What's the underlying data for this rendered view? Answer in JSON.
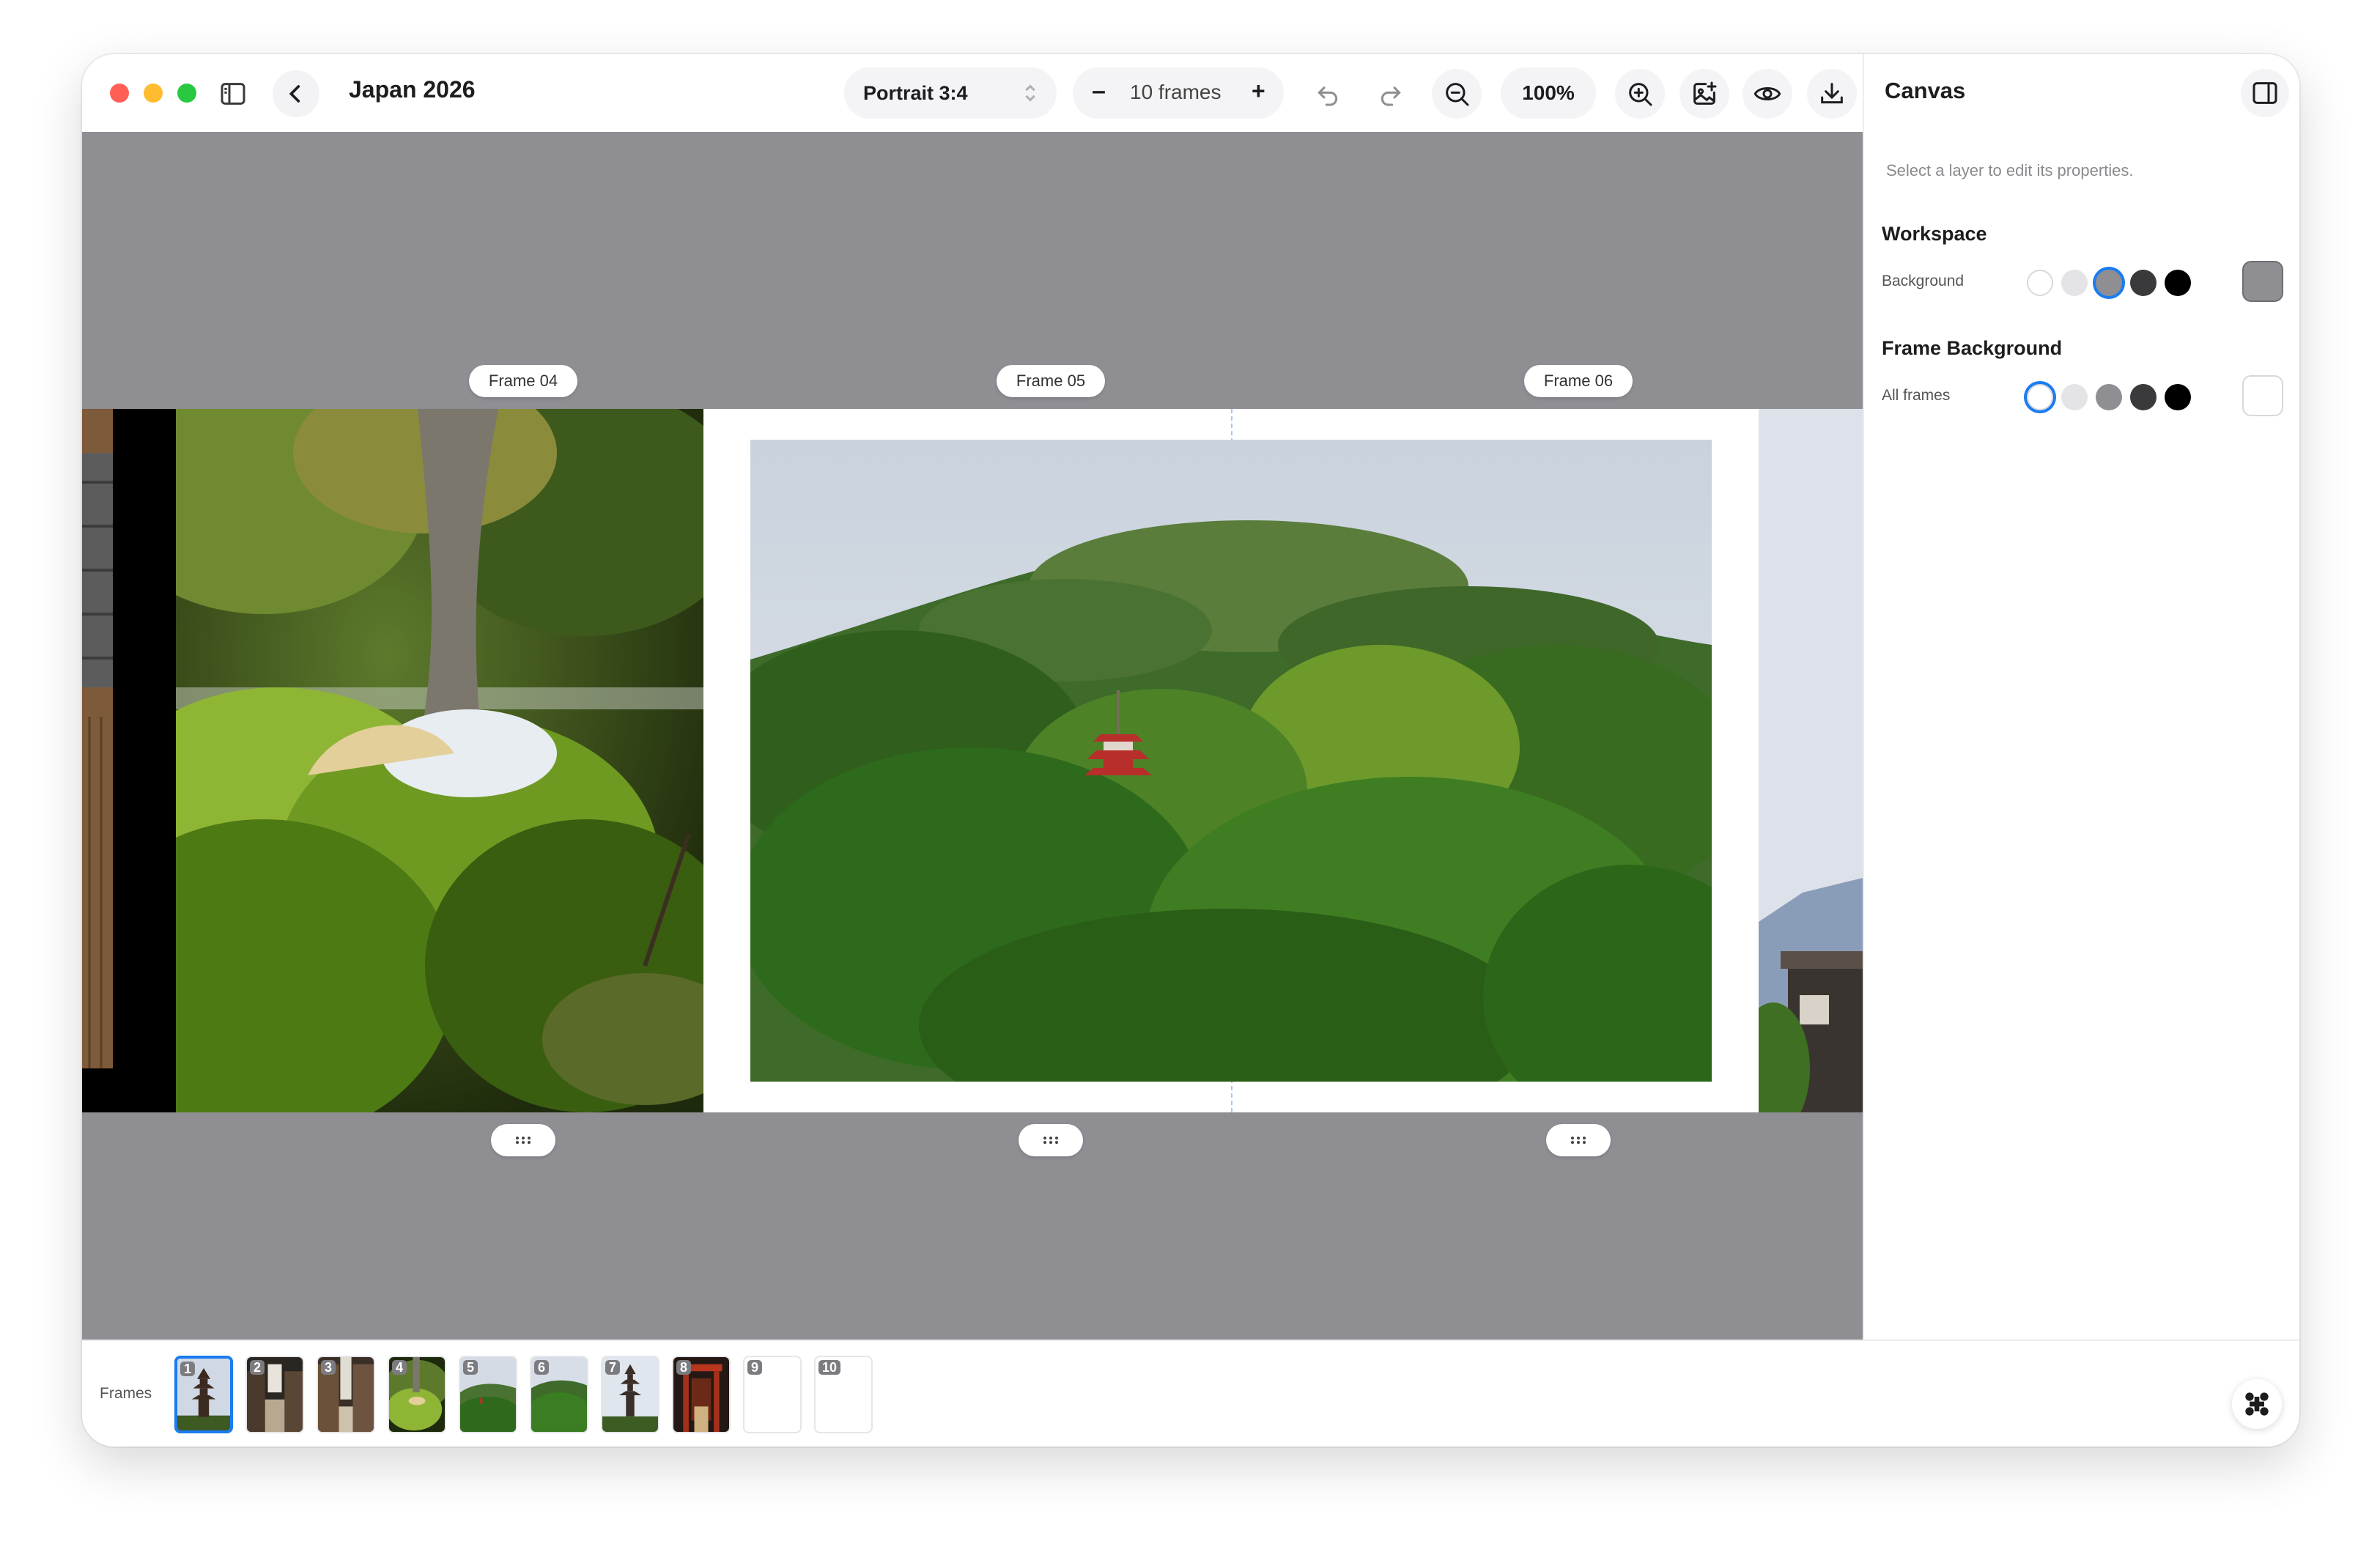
{
  "app": {
    "title": "Japan 2026"
  },
  "toolbar": {
    "aspect_ratio": "Portrait 3:4",
    "frame_count": "10 frames",
    "minus": "–",
    "plus": "+",
    "zoom": "100%"
  },
  "canvas": {
    "background": "#8e8e93",
    "frame_labels": [
      "Frame 04",
      "Frame 05",
      "Frame 06"
    ]
  },
  "panel": {
    "title": "Canvas",
    "hint": "Select a layer to edit its properties.",
    "workspace": {
      "title": "Workspace",
      "label": "Background",
      "swatches": [
        "#ffffff",
        "#e4e4e6",
        "#8e8e93",
        "#3a3a3c",
        "#000000"
      ],
      "selected": "#8e8e93",
      "current": "#8e8e93"
    },
    "frame_background": {
      "title": "Frame Background",
      "label": "All frames",
      "swatches": [
        "#ffffff",
        "#e4e4e6",
        "#8e8e93",
        "#3a3a3c",
        "#000000"
      ],
      "selected": "#ffffff",
      "current": "#ffffff"
    }
  },
  "strip": {
    "label": "Frames",
    "thumbs": [
      "1",
      "2",
      "3",
      "4",
      "5",
      "6",
      "7",
      "8",
      "9",
      "10"
    ],
    "selected": "1"
  },
  "accent": "#1a7cf0"
}
